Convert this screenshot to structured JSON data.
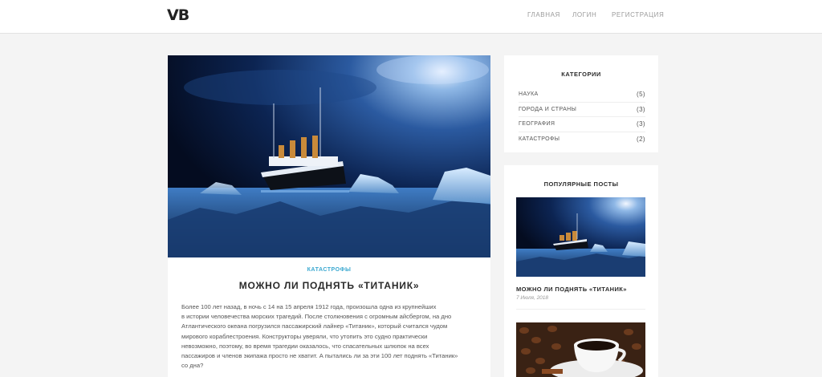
{
  "header": {
    "logo": "VB",
    "nav": [
      "ГЛАВНАЯ",
      "ЛОГИН",
      "РЕГИСТРАЦИЯ"
    ]
  },
  "post": {
    "category": "КАТАСТРОФЫ",
    "title": "МОЖНО ЛИ ПОДНЯТЬ «ТИТАНИК»",
    "body": [
      "Более 100 лет назад, в ночь с 14 на 15 апреля 1912 года, произошла одна из крупнейших",
      "в истории человечества морских трагедий. После столкновения с огромным айсбергом, на дно",
      "Атлантического океана погрузился пассажирский лайнер «Титаник», который считался чудом",
      "мирового кораблестроения. Конструкторы уверяли, что утопить это судно практически",
      "невозможно, поэтому, во время трагедии оказалось, что спасательных шлюпок на всех",
      "пассажиров и членов экипажа просто не хватит. А пытались ли за эти 100 лет поднять «Титаник»",
      "со дна?"
    ]
  },
  "sidebar": {
    "categories": {
      "title": "КАТЕГОРИИ",
      "items": [
        {
          "name": "НАУКА",
          "count": "(5)"
        },
        {
          "name": "ГОРОДА И СТРАНЫ",
          "count": "(3)"
        },
        {
          "name": "ГЕОГРАФИЯ",
          "count": "(3)"
        },
        {
          "name": "КАТАСТРОФЫ",
          "count": "(2)"
        }
      ]
    },
    "popular": {
      "title": "ПОПУЛЯРНЫЕ ПОСТЫ",
      "posts": [
        {
          "title": "МОЖНО ЛИ ПОДНЯТЬ «ТИТАНИК»",
          "date": "7 Июля, 2018"
        }
      ]
    }
  },
  "colors": {
    "accent": "#3aa8d0",
    "background": "#f4f4f4",
    "card": "#ffffff"
  },
  "icons": [
    "titanic-image",
    "coffee-image"
  ]
}
